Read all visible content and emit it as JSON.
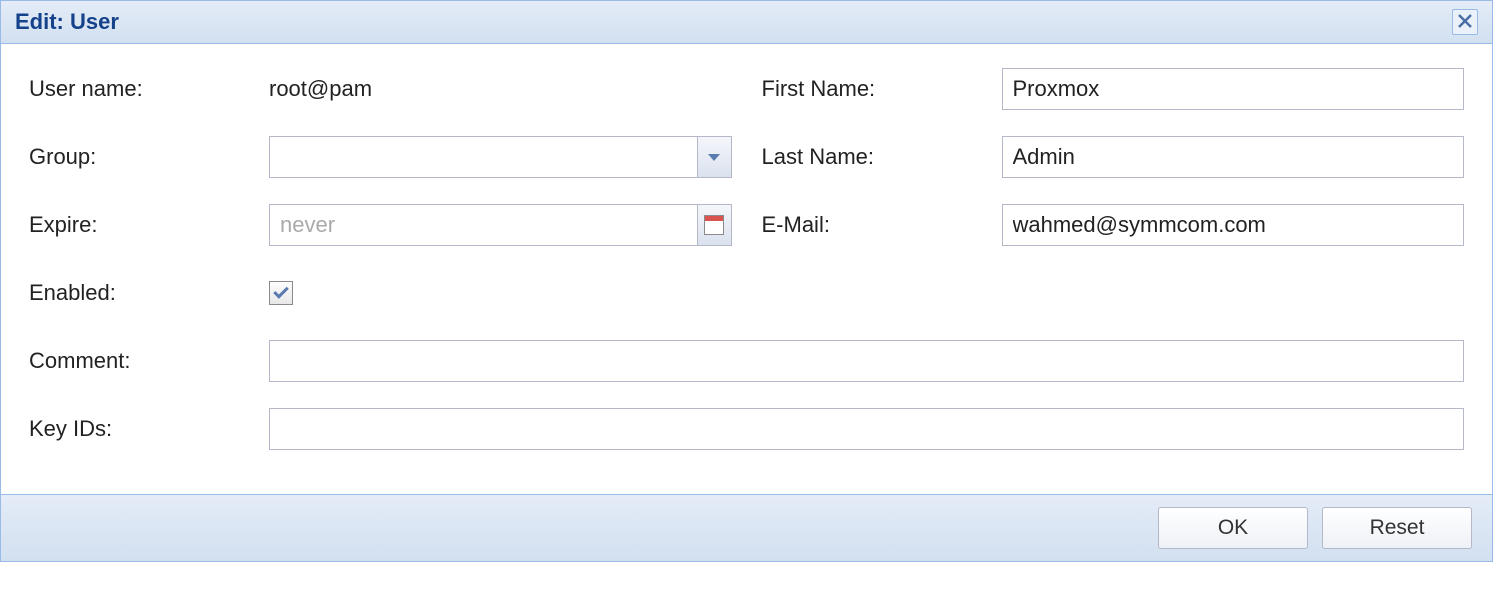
{
  "dialog": {
    "title": "Edit: User"
  },
  "left": {
    "username_label": "User name:",
    "username_value": "root@pam",
    "group_label": "Group:",
    "group_value": "",
    "expire_label": "Expire:",
    "expire_value": "",
    "expire_placeholder": "never",
    "enabled_label": "Enabled:",
    "enabled_checked": true
  },
  "right": {
    "firstname_label": "First Name:",
    "firstname_value": "Proxmox",
    "lastname_label": "Last Name:",
    "lastname_value": "Admin",
    "email_label": "E-Mail:",
    "email_value": "wahmed@symmcom.com"
  },
  "bottom": {
    "comment_label": "Comment:",
    "comment_value": "",
    "keyids_label": "Key IDs:",
    "keyids_value": ""
  },
  "buttons": {
    "ok": "OK",
    "reset": "Reset"
  }
}
